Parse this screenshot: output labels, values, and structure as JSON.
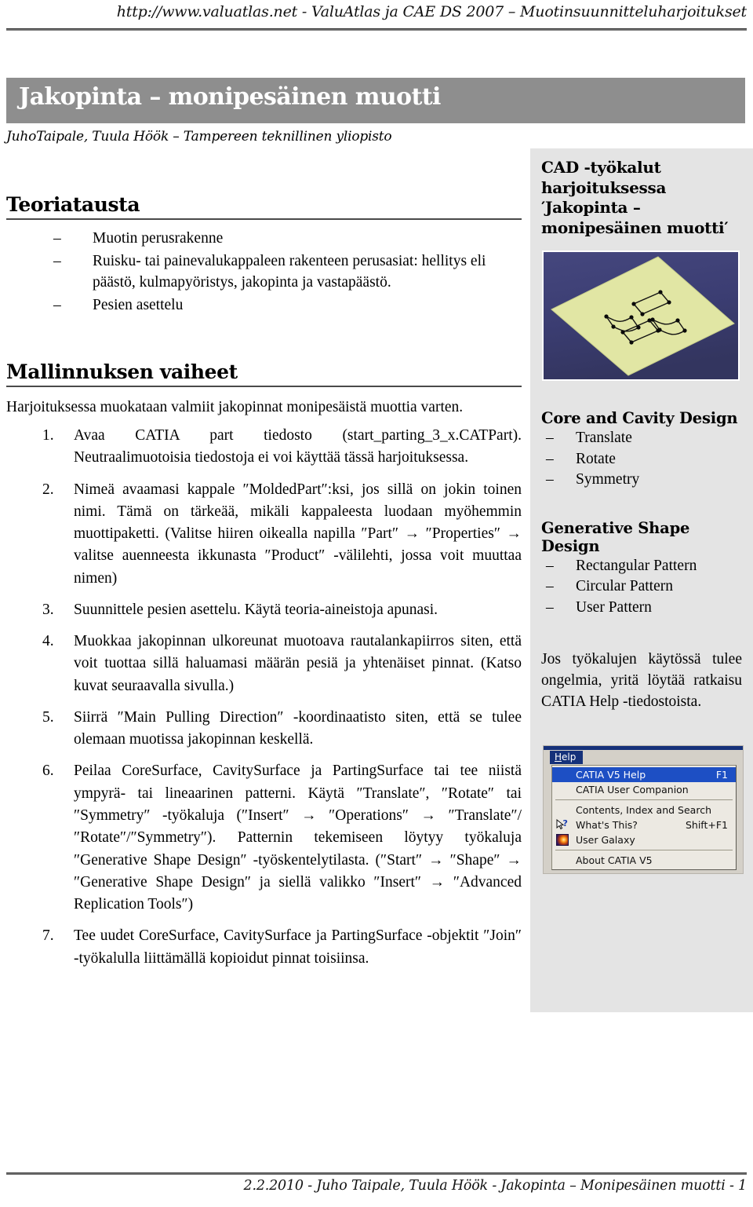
{
  "header": {
    "running_head": "http://www.valuatlas.net - ValuAtlas ja CAE DS 2007 – Muotinsuunnitteluharjoitukset"
  },
  "title": {
    "banner_text": "Jakopinta – monipesäinen muotti",
    "banner_bg": "#8e8e8e",
    "banner_fg": "#ffffff",
    "byline": "JuhoTaipale, Tuula Höök – Tampereen teknillinen yliopisto"
  },
  "theory": {
    "heading": "Teoriatausta",
    "bullet_marker": "–",
    "items": [
      "Muotin perusrakenne",
      "Ruisku- tai painevalukappaleen rakenteen perusasiat: hellitys eli päästö, kulmapyöristys, jakopinta ja vastapäästö.",
      "Pesien asettelu"
    ]
  },
  "steps_section": {
    "heading": "Mallinnuksen vaiheet",
    "lead": "Harjoituksessa muokataan valmiit jakopinnat monipesäistä muottia varten.",
    "items": [
      "Avaa CATIA part tiedosto (start_parting_3_x.CATPart). Neutraalimuotoisia tiedostoja ei voi käyttää tässä harjoituksessa.",
      "Nimeä avaamasi kappale ″MoldedPart″:ksi, jos sillä on jokin toinen nimi. Tämä on tärkeää, mikäli kappaleesta luodaan myöhemmin muottipaketti. (Valitse hiiren oikealla napilla ″Part″ → ″Properties″ → valitse auenneesta ikkunasta ″Product″ -välilehti, jossa voit muuttaa nimen)",
      "Suunnittele pesien asettelu. Käytä teoria-aineistoja apunasi.",
      "Muokkaa jakopinnan ulkoreunat muotoava rautalankapiirros siten, että voit tuottaa sillä haluamasi määrän pesiä ja yhtenäiset pinnat. (Katso kuvat seuraavalla sivulla.)",
      "Siirrä ″Main Pulling Direction″ -koordinaatisto siten, että se tulee olemaan muotissa jakopinnan keskellä.",
      "Peilaa CoreSurface, CavitySurface ja PartingSurface tai tee niistä ympyrä- tai lineaarinen patterni. Käytä ″Translate″, ″Rotate″ tai ″Symmetry″ -työkaluja (″Insert″ → ″Operations″ → ″Translate″/″Rotate″/″Symmetry″). Patternin tekemiseen löytyy työkaluja ″Generative Shape Design″ -työskentelytilasta. (″Start″ → ″Shape″ → ″Generative Shape Design″ ja siellä valikko ″Insert″ → ″Advanced Replication Tools″)",
      "Tee uudet CoreSurface, CavitySurface ja PartingSurface -objektit ″Join″ -työkalulla liittämällä kopioidut pinnat toisiinsa."
    ]
  },
  "sidebar": {
    "bg": "#e4e4e4",
    "title": "CAD -työkalut harjoituksessa ′Jakopinta – monipesäinen muotti′",
    "figure": {
      "name": "cad-parting-surface-illustration",
      "background_color": "#3b3d72",
      "plane_color": "#e1e6a4",
      "wire_color": "#1a1a1a",
      "cavity_count": 4
    },
    "blocks": [
      {
        "heading": "Core and Cavity Design",
        "marker": "–",
        "items": [
          "Translate",
          "Rotate",
          "Symmetry"
        ]
      },
      {
        "heading": "Generative Shape Design",
        "marker": "–",
        "items": [
          "Rectangular Pattern",
          "Circular Pattern",
          "User Pattern"
        ]
      }
    ],
    "note": "Jos työkalujen käytössä tulee ongelmia, yritä löytää ratkaisu CATIA Help -tiedostoista."
  },
  "help_menu": {
    "menubar_label": "Help",
    "menubar_accesskey": "H",
    "highlight_color": "#1d4fc4",
    "titlebar_color": "#15317a",
    "items": [
      {
        "label": "CATIA V5 Help",
        "accel": "F1",
        "selected": true,
        "icon": ""
      },
      {
        "label": "CATIA User Companion",
        "accel": "",
        "selected": false,
        "icon": ""
      },
      {
        "separator": true
      },
      {
        "label": "Contents, Index and Search",
        "accel": "",
        "selected": false,
        "icon": ""
      },
      {
        "label": "What's This?",
        "accel": "Shift+F1",
        "selected": false,
        "icon": "whats-this-icon"
      },
      {
        "label": "User Galaxy",
        "accel": "",
        "selected": false,
        "icon": "user-galaxy-icon"
      },
      {
        "separator": true
      },
      {
        "label": "About CATIA V5",
        "accel": "",
        "selected": false,
        "icon": ""
      }
    ]
  },
  "footer": {
    "text": "2.2.2010 - Juho Taipale, Tuula Höök - Jakopinta – Monipesäinen muotti - 1"
  }
}
